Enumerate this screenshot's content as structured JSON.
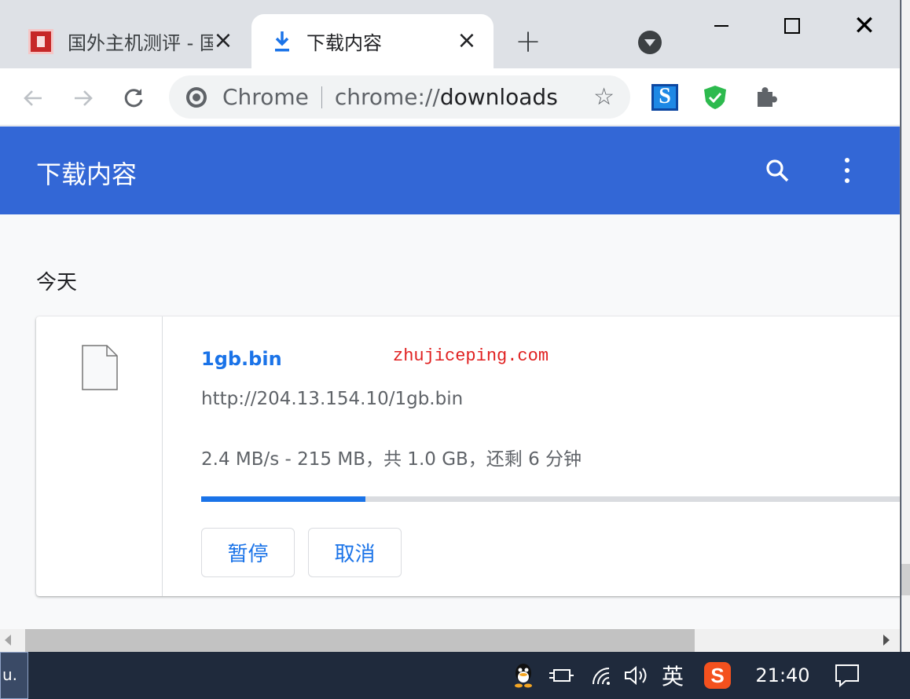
{
  "tabs": [
    {
      "title": "国外主机测评 - 国",
      "active": false
    },
    {
      "title": "下载内容",
      "active": true
    }
  ],
  "toolbar": {
    "omnibox_scheme": "Chrome",
    "omnibox_url_prefix": "chrome://",
    "omnibox_url_host": "downloads"
  },
  "page": {
    "header_title": "下载内容",
    "section_title": "今天"
  },
  "download": {
    "file_name": "1gb.bin",
    "watermark": "zhujiceping.com",
    "url": "http://204.13.154.10/1gb.bin",
    "status": "2.4 MB/s - 215 MB，共 1.0 GB，还剩 6 分钟",
    "progress_fraction": 0.23,
    "pause_label": "暂停",
    "cancel_label": "取消"
  },
  "taskbar": {
    "ime_label": "英",
    "sogou_label": "S",
    "clock": "21:40",
    "task_item_label": "u."
  },
  "colors": {
    "header_blue": "#3367d6",
    "link_blue": "#1a73e8",
    "watermark_red": "#e02020"
  },
  "icons": [
    "download-arrow-icon",
    "tab-close-icon",
    "new-tab-icon",
    "tab-search-icon",
    "minimize-icon",
    "maximize-icon",
    "window-close-icon",
    "back-icon",
    "forward-icon",
    "reload-icon",
    "chrome-logo-icon",
    "bookmark-star-icon",
    "extension-s-icon",
    "extension-shield-icon",
    "extensions-puzzle-icon",
    "search-icon",
    "more-vert-icon",
    "file-icon",
    "qq-icon",
    "power-plug-icon",
    "wifi-icon",
    "volume-icon",
    "sogou-icon",
    "notification-icon"
  ]
}
